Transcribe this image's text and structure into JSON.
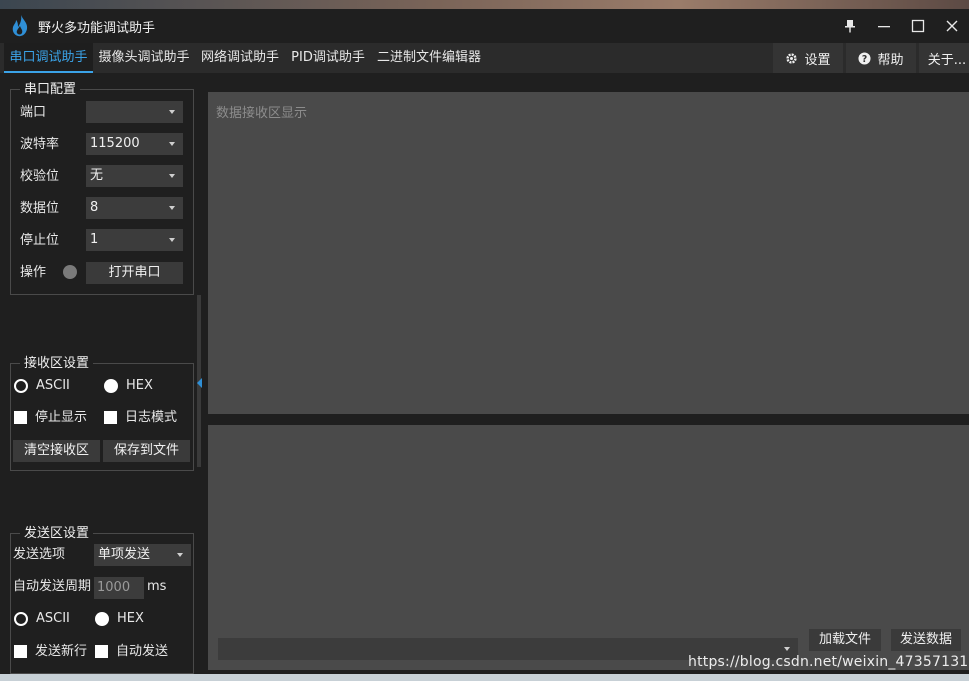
{
  "window": {
    "title": "野火多功能调试助手"
  },
  "tabs": [
    {
      "label": "串口调试助手",
      "active": true
    },
    {
      "label": "摄像头调试助手"
    },
    {
      "label": "网络调试助手"
    },
    {
      "label": "PID调试助手"
    },
    {
      "label": "二进制文件编辑器"
    }
  ],
  "toolbar": {
    "settings": {
      "label": "设置",
      "icon": "gear-icon"
    },
    "help": {
      "label": "帮助",
      "icon": "question-icon"
    },
    "about": {
      "label": "关于..."
    }
  },
  "serial_config": {
    "title": "串口配置",
    "port": {
      "label": "端口",
      "value": ""
    },
    "baud": {
      "label": "波特率",
      "value": "115200"
    },
    "parity": {
      "label": "校验位",
      "value": "无"
    },
    "databits": {
      "label": "数据位",
      "value": "8"
    },
    "stopbits": {
      "label": "停止位",
      "value": "1"
    },
    "operation": {
      "label": "操作",
      "open_button": "打开串口"
    }
  },
  "recv_settings": {
    "title": "接收区设置",
    "ascii": "ASCII",
    "hex": "HEX",
    "stop_display": "停止显示",
    "log_mode": "日志模式",
    "clear_button": "清空接收区",
    "save_button": "保存到文件"
  },
  "send_settings": {
    "title": "发送区设置",
    "option_label": "发送选项",
    "option_value": "单项发送",
    "period_label": "自动发送周期",
    "period_value": "1000",
    "period_unit": "ms",
    "ascii": "ASCII",
    "hex": "HEX",
    "newline": "发送新行",
    "auto_send": "自动发送"
  },
  "recv_area": {
    "placeholder": "数据接收区显示"
  },
  "send_bar": {
    "load_file": "加载文件",
    "send_data": "发送数据"
  },
  "watermark": "https://blog.csdn.net/weixin_47357131",
  "colors": {
    "accent": "#3ba3e8",
    "background": "#1f1f1f",
    "panel": "#4a4a4a"
  }
}
